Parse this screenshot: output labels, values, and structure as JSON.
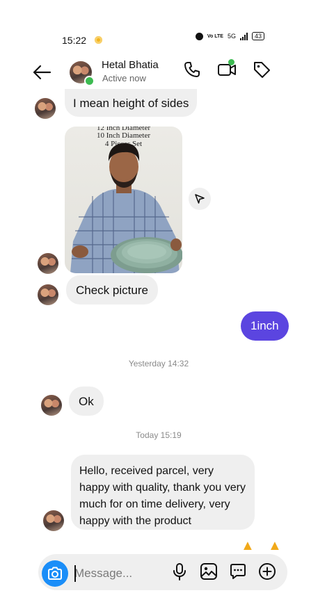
{
  "status_bar": {
    "time": "15:22",
    "volte": "Vo LTE",
    "network": "5G",
    "battery": "43"
  },
  "header": {
    "contact_name": "Hetal Bhatia",
    "contact_status": "Active now"
  },
  "messages": {
    "m1": "I mean height of sides",
    "photo_caption": [
      "12 Inch Diameter",
      "10 Inch Diameter",
      "4 Pieces Set"
    ],
    "m2": "Check picture",
    "sent1": "1inch",
    "timestamp1": "Yesterday 14:32",
    "m3": "Ok",
    "timestamp2": "Today 15:19",
    "m4": "Hello, received parcel, very happy with quality, thank you very much  for on time delivery, very  happy with the product",
    "reactions": "🙏 🙏"
  },
  "composer": {
    "placeholder": "Message..."
  },
  "colors": {
    "sent_bubble": "#5b45e0",
    "camera_button": "#1b8ef8",
    "online": "#3dbb52",
    "received_bubble": "#efefef"
  }
}
